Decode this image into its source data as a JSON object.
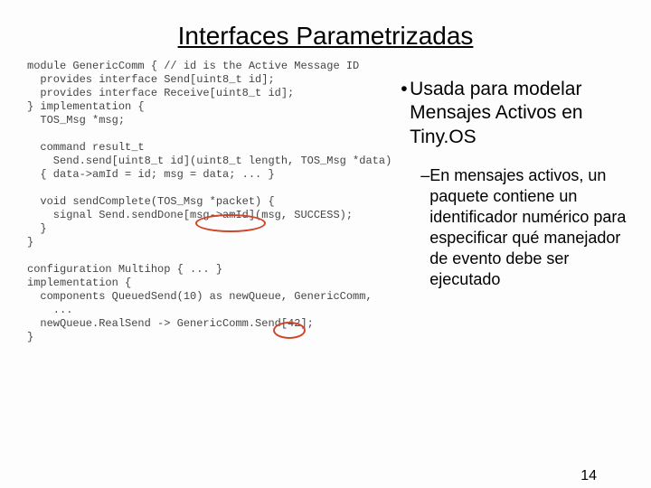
{
  "title": "Interfaces Parametrizadas",
  "code": "module GenericComm { // id is the Active Message ID\n  provides interface Send[uint8_t id];\n  provides interface Receive[uint8_t id];\n} implementation {\n  TOS_Msg *msg;\n\n  command result_t\n    Send.send[uint8_t id](uint8_t length, TOS_Msg *data)\n  { data->amId = id; msg = data; ... }\n\n  void sendComplete(TOS_Msg *packet) {\n    signal Send.sendDone[msg->amId](msg, SUCCESS);\n  }\n}\n\nconfiguration Multihop { ... }\nimplementation {\n  components QueuedSend(10) as newQueue, GenericComm,\n    ...\n  newQueue.RealSend -> GenericComm.Send[42];\n}",
  "bullets": {
    "b1": "Usada para modelar Mensajes Activos en Tiny.OS",
    "b2": "En mensajes activos, un paquete contiene un identificador numérico para especificar qué manejador de evento debe ser ejecutado"
  },
  "page": "14"
}
